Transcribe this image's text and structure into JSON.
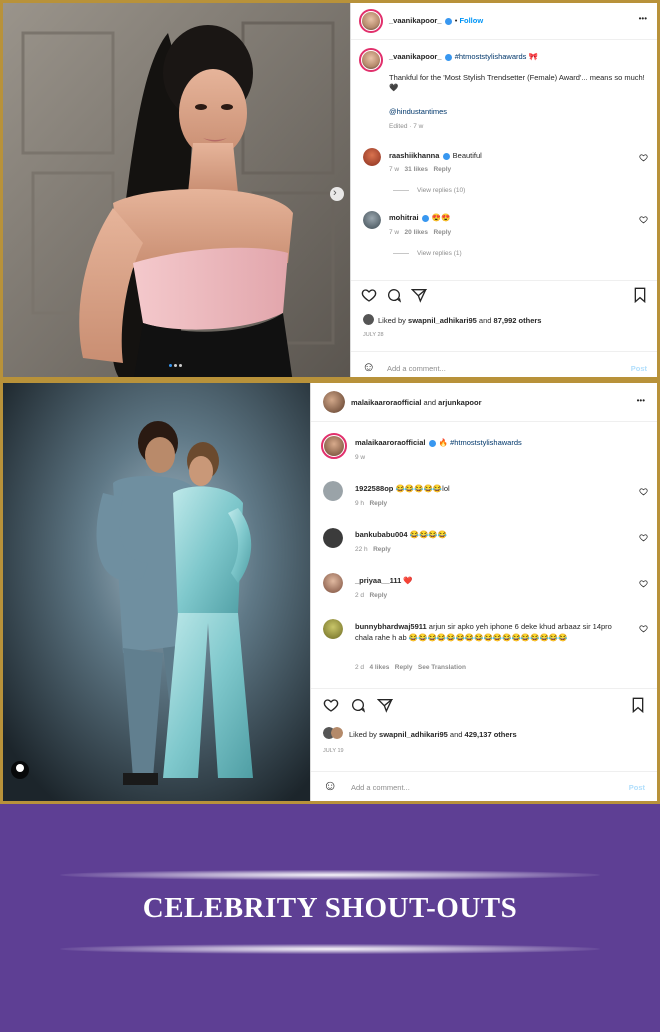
{
  "post1": {
    "username": "_vaanikapoor_",
    "follow_label": "Follow",
    "more_label": "•••",
    "caption_username": "_vaanikapoor_",
    "caption_hashtag": "#htmoststylishawards",
    "caption_text": "Thankful for the 'Most Stylish Trendsetter (Female) Award'... means so much!",
    "caption_mention": "@hindustantimes",
    "caption_meta": "Edited · 7 w",
    "comments": [
      {
        "username": "raashiikhanna",
        "text": "Beautiful",
        "time": "7 w",
        "likes": "31 likes",
        "reply": "Reply",
        "view_replies": "View replies (10)"
      },
      {
        "username": "mohitrai",
        "text": "",
        "time": "7 w",
        "likes": "20 likes",
        "reply": "Reply",
        "view_replies": "View replies (1)"
      }
    ],
    "liked_prefix": "Liked by",
    "liked_user": "swapnil_adhikari95",
    "liked_suffix": "and",
    "liked_others": "87,992 others",
    "date": "JULY 28",
    "add_comment": "Add a comment...",
    "post_label": "Post"
  },
  "post2": {
    "header_user1": "malaikaaroraofficial",
    "header_and": "and",
    "header_user2": "arjunkapoor",
    "more_label": "•••",
    "caption_username": "malaikaaroraofficial",
    "caption_hashtag": "#htmoststylishawards",
    "caption_meta": "9 w",
    "comments": [
      {
        "username": "1922588op",
        "text": "😂😂😂😂😂lol",
        "time": "9 h",
        "likes": "",
        "reply": "Reply",
        "see_translation": ""
      },
      {
        "username": "bankubabu004",
        "text": "😂😂😂😂",
        "time": "22 h",
        "likes": "",
        "reply": "Reply",
        "see_translation": ""
      },
      {
        "username": "_priyaa__111",
        "text": "❤️",
        "time": "2 d",
        "likes": "",
        "reply": "Reply",
        "see_translation": ""
      },
      {
        "username": "bunnybhardwaj5911",
        "text": "arjun sir apko yeh iphone 6 deke khud arbaaz sir 14pro chala rahe h ab 😂😂😂😂😂😂😂😂😂😂😂😂😂😂😂😂😂",
        "time": "2 d",
        "likes": "4 likes",
        "reply": "Reply",
        "see_translation": "See Translation"
      }
    ],
    "liked_prefix": "Liked by",
    "liked_user": "swapnil_adhikari95",
    "liked_suffix": "and",
    "liked_others": "429,137 others",
    "date": "JULY 19",
    "add_comment": "Add a comment...",
    "post_label": "Post"
  },
  "banner": {
    "title": "CELEBRITY SHOUT-OUTS"
  },
  "colors": {
    "banner_bg": "#5e3f94",
    "frame_border": "#b8923a",
    "link": "#00376b",
    "verified": "#3897f0"
  }
}
